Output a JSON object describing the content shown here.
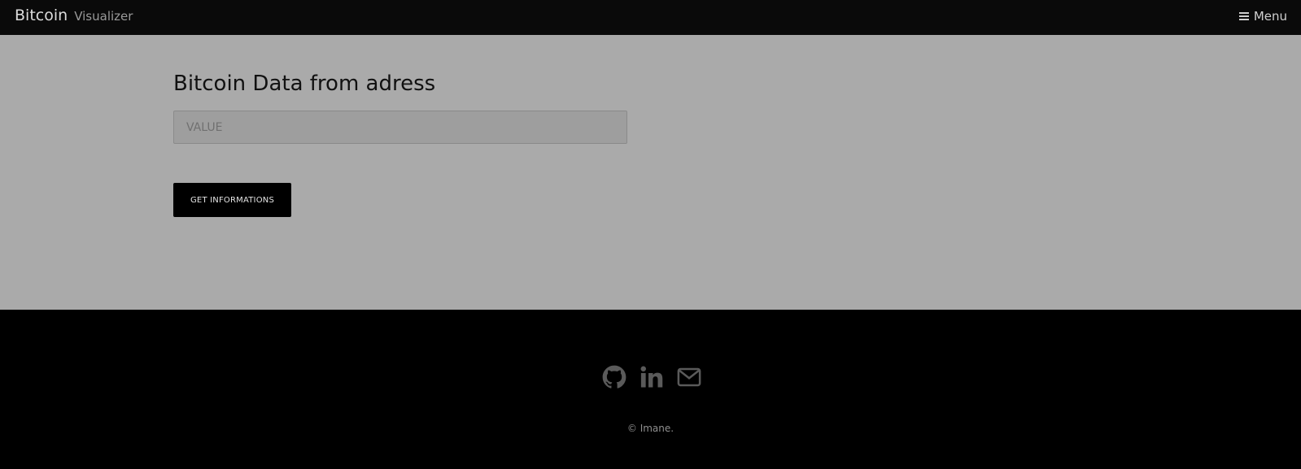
{
  "navbar": {
    "brand_main": "Bitcoin",
    "brand_sub": "Visualizer",
    "menu_label": "Menu",
    "menu_icon": "hamburger-icon"
  },
  "main": {
    "title": "Bitcoin Data from adress",
    "input": {
      "value": "",
      "placeholder": "VALUE"
    },
    "button_label": "GET INFORMATIONS"
  },
  "footer": {
    "social_icons": [
      "github-icon",
      "linkedin-icon",
      "envelope-icon"
    ],
    "copyright": "© Imane."
  },
  "colors": {
    "navbar_bg": "#0a0a0a",
    "main_bg": "#aaaaaa",
    "input_bg": "#9e9e9e",
    "button_bg": "#000000",
    "footer_bg": "#000000",
    "icon_color": "#5a5a5a"
  }
}
